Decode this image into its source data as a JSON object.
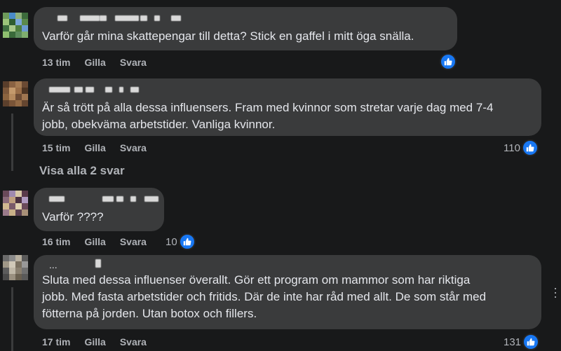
{
  "comments": [
    {
      "text": "Varför går mina skattepengar till detta? Stick en gaffel i mitt öga snälla.",
      "time": "13 tim",
      "like": "Gilla",
      "reply": "Svara",
      "reaction_count": ""
    },
    {
      "text": "Är så trött på alla dessa influensers. Fram med kvinnor som stretar varje dag med 7-4\njobb, obekväma arbetstider. Vanliga kvinnor.",
      "time": "15 tim",
      "like": "Gilla",
      "reply": "Svara",
      "reaction_count": "110"
    },
    {
      "text": "Varför ????",
      "time": "16 tim",
      "like": "Gilla",
      "reply": "Svara",
      "reaction_count": "10"
    },
    {
      "name_partial": "...",
      "text": "Sluta med dessa influenser överallt. Gör ett program om mammor som har riktiga\njobb. Med fasta arbetstider och fritids. Där de inte har råd med allt. De som står med\nfötterna på jorden. Utan botox och fillers.",
      "time": "17 tim",
      "like": "Gilla",
      "reply": "Svara",
      "reaction_count": "131"
    }
  ],
  "view_replies": "Visa alla 2 svar",
  "colors": {
    "background": "#18191a",
    "bubble": "#3a3b3c",
    "text": "#e4e6eb",
    "meta": "#b0b3b8",
    "like_blue": "#1877f2"
  },
  "icons": {
    "reaction": "thumbs-up-icon",
    "more": "more-options-icon"
  }
}
